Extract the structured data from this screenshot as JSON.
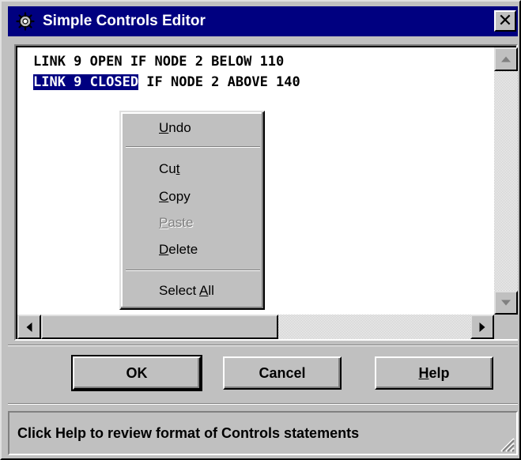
{
  "window": {
    "title": "Simple Controls Editor",
    "title_icon": "gear-icon",
    "close_label": "✕",
    "colors": {
      "titlebar": "#000080",
      "face": "#c0c0c0",
      "selection": "#000080"
    }
  },
  "editor": {
    "lines": [
      {
        "text": "LINK 9 OPEN IF NODE 2 BELOW 110"
      },
      {
        "selected": "LINK 9 CLOSED",
        "rest": " IF NODE 2 ABOVE 140"
      }
    ]
  },
  "context_menu": {
    "undo": {
      "pre": "",
      "key": "U",
      "post": "ndo"
    },
    "cut": {
      "pre": "Cu",
      "key": "t",
      "post": ""
    },
    "copy": {
      "pre": "",
      "key": "C",
      "post": "opy"
    },
    "paste": {
      "pre": "",
      "key": "P",
      "post": "aste",
      "disabled": true
    },
    "delete": {
      "pre": "",
      "key": "D",
      "post": "elete"
    },
    "select_all": {
      "pre": "Select ",
      "key": "A",
      "post": "ll"
    }
  },
  "buttons": {
    "ok": "OK",
    "cancel": "Cancel",
    "help": {
      "pre": "",
      "key": "H",
      "post": "elp"
    }
  },
  "status": {
    "text": "Click Help to review format of Controls statements"
  }
}
